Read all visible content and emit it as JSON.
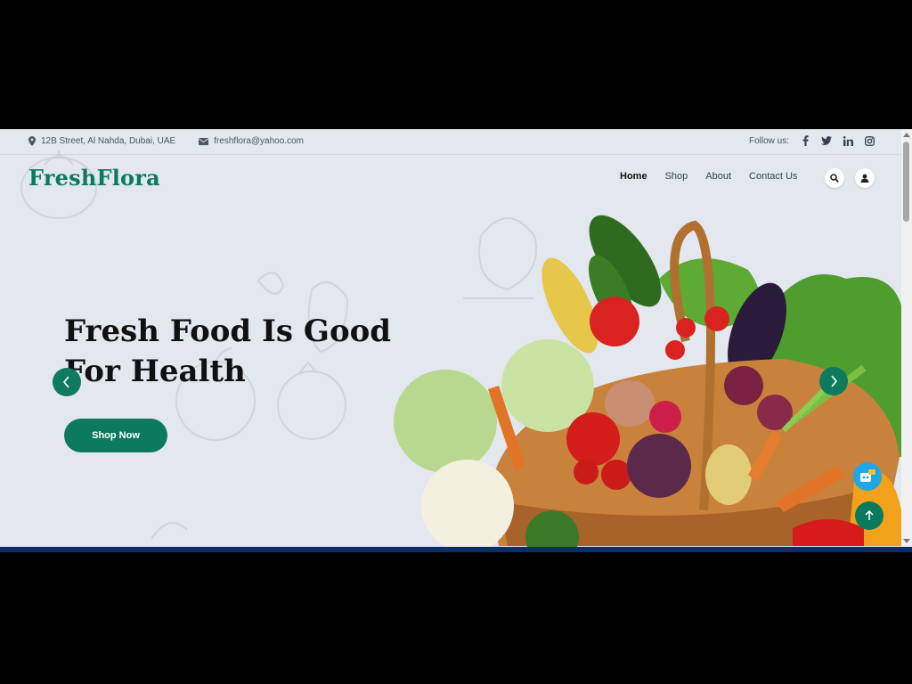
{
  "topbar": {
    "address": "12B Street, Al Nahda, Dubai, UAE",
    "email": "freshflora@yahoo.com",
    "follow_label": "Follow us:",
    "social_icons": [
      "facebook-icon",
      "twitter-icon",
      "linkedin-icon",
      "instagram-icon"
    ]
  },
  "brand": "FreshFlora",
  "nav": {
    "items": [
      {
        "label": "Home",
        "active": true
      },
      {
        "label": "Shop",
        "active": false
      },
      {
        "label": "About",
        "active": false
      },
      {
        "label": "Contact Us",
        "active": false
      }
    ]
  },
  "hero": {
    "title": "Fresh Food Is Good For Health",
    "cta": "Shop Now"
  },
  "colors": {
    "brand_green": "#0b7a5e",
    "page_bg": "#e3e7ee",
    "chat_blue": "#1ea7e6"
  },
  "icons": {
    "location": "location-pin-icon",
    "email": "envelope-icon",
    "search": "search-icon",
    "user": "user-icon",
    "prev": "chevron-left-icon",
    "next": "chevron-right-icon",
    "scroll_top": "arrow-up-icon",
    "chat": "chat-bot-icon"
  }
}
